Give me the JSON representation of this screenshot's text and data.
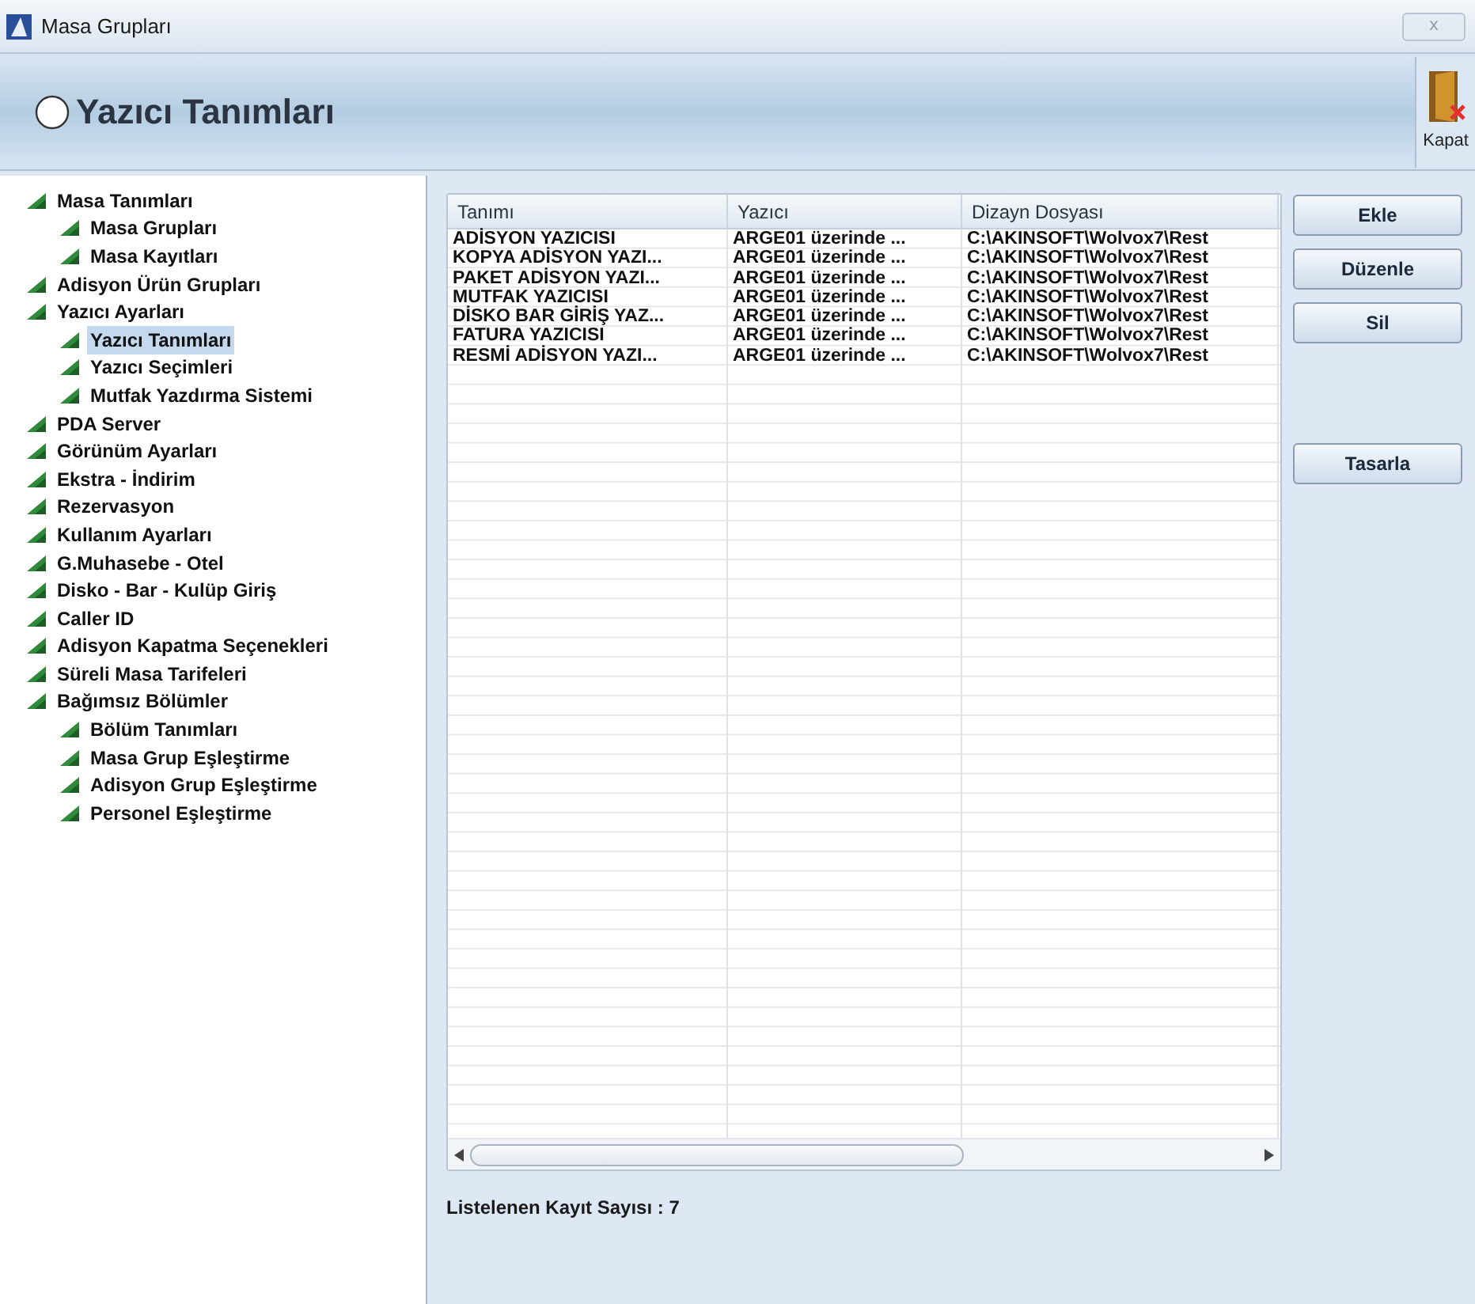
{
  "window": {
    "title": "Masa Grupları",
    "close": "x"
  },
  "header": {
    "title": "Yazıcı Tanımları",
    "close_label": "Kapat"
  },
  "tree": [
    {
      "label": "Masa Tanımları",
      "selected": false,
      "children": [
        {
          "label": "Masa Grupları",
          "selected": false
        },
        {
          "label": "Masa Kayıtları",
          "selected": false
        }
      ]
    },
    {
      "label": "Adisyon Ürün Grupları",
      "selected": false
    },
    {
      "label": "Yazıcı Ayarları",
      "selected": false,
      "children": [
        {
          "label": "Yazıcı Tanımları",
          "selected": true
        },
        {
          "label": "Yazıcı Seçimleri",
          "selected": false
        },
        {
          "label": "Mutfak Yazdırma Sistemi",
          "selected": false
        }
      ]
    },
    {
      "label": "PDA Server",
      "selected": false
    },
    {
      "label": "Görünüm Ayarları",
      "selected": false
    },
    {
      "label": "Ekstra - İndirim",
      "selected": false
    },
    {
      "label": "Rezervasyon",
      "selected": false
    },
    {
      "label": "Kullanım Ayarları",
      "selected": false
    },
    {
      "label": "G.Muhasebe - Otel",
      "selected": false
    },
    {
      "label": "Disko - Bar - Kulüp Giriş",
      "selected": false
    },
    {
      "label": "Caller ID",
      "selected": false
    },
    {
      "label": "Adisyon Kapatma Seçenekleri",
      "selected": false
    },
    {
      "label": "Süreli Masa Tarifeleri",
      "selected": false
    },
    {
      "label": "Bağımsız Bölümler",
      "selected": false,
      "children": [
        {
          "label": "Bölüm Tanımları",
          "selected": false
        },
        {
          "label": "Masa Grup Eşleştirme",
          "selected": false
        },
        {
          "label": "Adisyon Grup Eşleştirme",
          "selected": false
        },
        {
          "label": "Personel Eşleştirme",
          "selected": false
        }
      ]
    }
  ],
  "table": {
    "columns": [
      "Tanımı",
      "Yazıcı",
      "Dizayn Dosyası"
    ],
    "rows": [
      [
        "ADİSYON YAZICISI",
        "ARGE01 üzerinde ...",
        "C:\\AKINSOFT\\Wolvox7\\Rest"
      ],
      [
        "KOPYA ADİSYON YAZI...",
        "ARGE01 üzerinde ...",
        "C:\\AKINSOFT\\Wolvox7\\Rest"
      ],
      [
        "PAKET ADİSYON YAZI...",
        "ARGE01 üzerinde ...",
        "C:\\AKINSOFT\\Wolvox7\\Rest"
      ],
      [
        "MUTFAK YAZICISI",
        "ARGE01 üzerinde ...",
        "C:\\AKINSOFT\\Wolvox7\\Rest"
      ],
      [
        "DİSKO BAR GİRİŞ YAZ...",
        "ARGE01 üzerinde ...",
        "C:\\AKINSOFT\\Wolvox7\\Rest"
      ],
      [
        "FATURA YAZICISI",
        "ARGE01 üzerinde ...",
        "C:\\AKINSOFT\\Wolvox7\\Rest"
      ],
      [
        "RESMİ ADİSYON YAZI...",
        "ARGE01 üzerinde ...",
        "C:\\AKINSOFT\\Wolvox7\\Rest"
      ]
    ]
  },
  "buttons": [
    "Ekle",
    "Düzenle",
    "Sil"
  ],
  "design_button": "Tasarla",
  "record_count": "Listelenen Kayıt Sayısı : 7"
}
